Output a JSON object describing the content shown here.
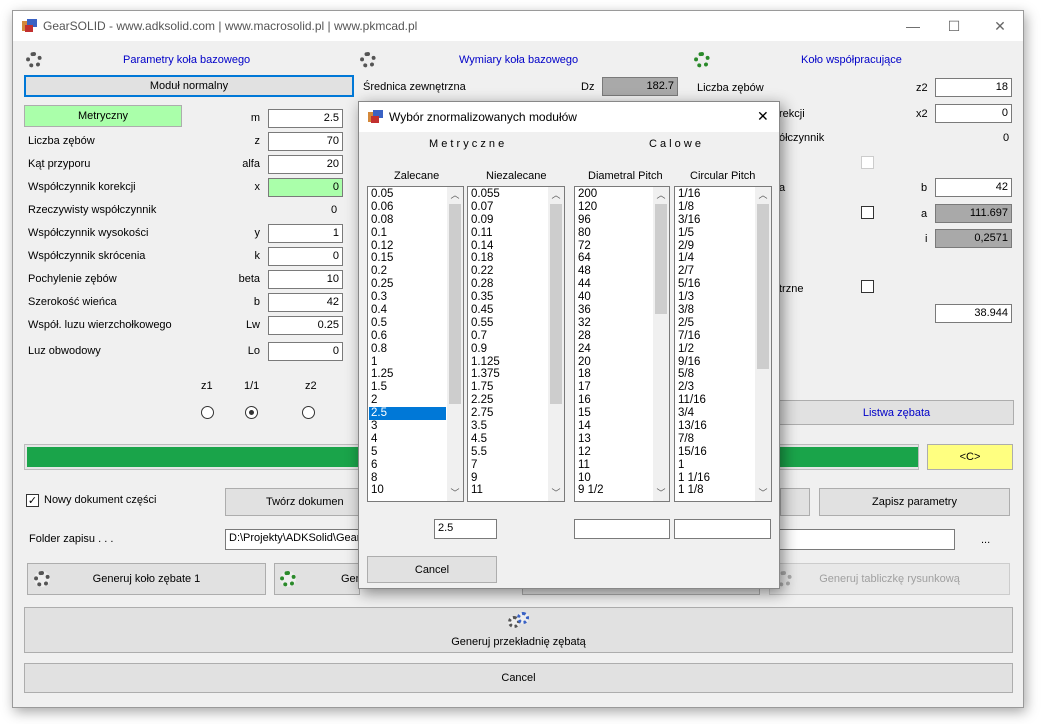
{
  "window": {
    "title": "GearSOLID  -  www.adksolid.com | www.macrosolid.pl | www.pkmcad.pl",
    "minimize": "—",
    "maximize": "☐",
    "close": "✕"
  },
  "left": {
    "header": "Parametry koła bazowego",
    "modul_btn": "Moduł normalny",
    "metryczny_btn": "Metryczny",
    "rows": [
      {
        "label": "",
        "sym": "m",
        "value": "2.5"
      },
      {
        "label": "Liczba zębów",
        "sym": "z",
        "value": "70"
      },
      {
        "label": "Kąt przyporu",
        "sym": "alfa",
        "value": "20"
      },
      {
        "label": "Współczynnik korekcji",
        "sym": "x",
        "value": "0"
      },
      {
        "label": "Rzeczywisty współczynnik",
        "sym": "",
        "value": "0"
      },
      {
        "label": "Współczynnik wysokości",
        "sym": "y",
        "value": "1"
      },
      {
        "label": "Współczynnik skrócenia",
        "sym": "k",
        "value": "0"
      },
      {
        "label": "Pochylenie zębów",
        "sym": "beta",
        "value": "10"
      },
      {
        "label": "Szerokość wieńca",
        "sym": "b",
        "value": "42"
      },
      {
        "label": "Współ. luzu wierzchołkowego",
        "sym": "Lw",
        "value": "0.25"
      },
      {
        "label": "Luz obwodowy",
        "sym": "Lo",
        "value": "0"
      }
    ],
    "radio_labels": [
      "z1",
      "1/1",
      "z2"
    ]
  },
  "middle": {
    "header": "Wymiary koła bazowego",
    "srednica_label": "Średnica zewnętrzna",
    "srednica_sym": "Dz",
    "srednica_value": "182.7"
  },
  "right": {
    "header": "Koło współpracujące",
    "liczba_label": "Liczba zębów",
    "z2_sym": "z2",
    "z2_value": "18",
    "korekcji_label": "rekcji",
    "x2_sym": "x2",
    "x2_value": "0",
    "wsp_label": "ółczynnik",
    "wsp_value": "0",
    "b_label": "a",
    "b_sym": "b",
    "b_value": "42",
    "a_sym": "a",
    "a_value": "111.697",
    "i_sym": "i",
    "i_value": "0,2571",
    "trzne_label": "trzne",
    "last_value": "38.944",
    "listwa_btn": "Listwa zębata"
  },
  "progress": {
    "fill": 1.0
  },
  "c_btn": "<C>",
  "bottom": {
    "nowy_label": "Nowy dokument części",
    "tworz_btn": "Twórz dokumen",
    "zapisz_btn": "Zapisz parametry",
    "folder_label": "Folder zapisu . . .",
    "folder_value": "D:\\Projekty\\ADKSolid\\Gear",
    "dots": "...",
    "gen1_btn": "Generuj koło zębate 1",
    "gen2_btn": "Gen",
    "gen_tab_btn": "Generuj tabliczkę rysunkową",
    "gen_przek_btn": "Generuj przekładnię zębatą",
    "cancel_btn": "Cancel"
  },
  "dialog": {
    "title": "Wybór znormalizowanych modułów",
    "close": "✕",
    "metryczne": "M e t r y c z n e",
    "calowe": "C a l o w e",
    "col_headers": [
      "Zalecane",
      "Niezalecane",
      "Diametral Pitch",
      "Circular Pitch"
    ],
    "zalecane": [
      "0.05",
      "0.06",
      "0.08",
      "0.1",
      "0.12",
      "0.15",
      "0.2",
      "0.25",
      "0.3",
      "0.4",
      "0.5",
      "0.6",
      "0.8",
      "1",
      "1.25",
      "1.5",
      "2",
      "2.5",
      "3",
      "4",
      "5",
      "6",
      "8",
      "10"
    ],
    "niezalecane": [
      "0.055",
      "0.07",
      "0.09",
      "0.11",
      "0.14",
      "0.18",
      "0.22",
      "0.28",
      "0.35",
      "0.45",
      "0.55",
      "0.7",
      "0.9",
      "1.125",
      "1.375",
      "1.75",
      "2.25",
      "2.75",
      "3.5",
      "4.5",
      "5.5",
      "7",
      "9",
      "11"
    ],
    "diametral": [
      "200",
      "120",
      "96",
      "80",
      "72",
      "64",
      "48",
      "44",
      "40",
      "36",
      "32",
      "28",
      "24",
      "20",
      "18",
      "17",
      "16",
      "15",
      "14",
      "13",
      "12",
      "11",
      "10",
      "9 1/2"
    ],
    "circular": [
      "1/16",
      "1/8",
      "3/16",
      "1/5",
      "2/9",
      "1/4",
      "2/7",
      "5/16",
      "1/3",
      "3/8",
      "2/5",
      "7/16",
      "1/2",
      "9/16",
      "5/8",
      "2/3",
      "11/16",
      "3/4",
      "13/16",
      "7/8",
      "15/16",
      "1",
      "1 1/16",
      "1 1/8"
    ],
    "selected_index": 17,
    "metric_value": "2.5",
    "dp_value": "",
    "cp_value": "",
    "cancel": "Cancel"
  },
  "colors": {
    "green_field": "#aaffaa",
    "progress": "#1aa44a",
    "c_btn": "#ffff80",
    "selection": "#0078d7",
    "readonly": "#a9a9a9"
  }
}
